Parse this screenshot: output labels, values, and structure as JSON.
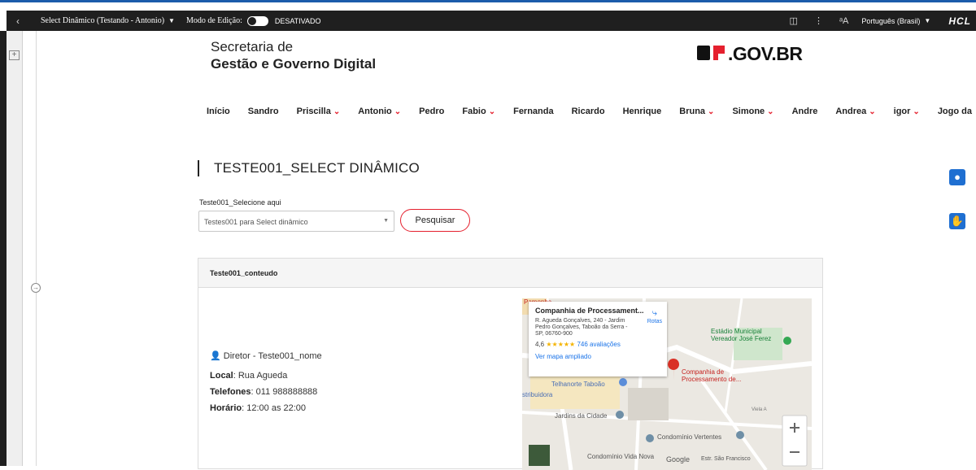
{
  "topbar": {
    "page_select": "Select Dinâmico (Testando - Antonio)",
    "edit_mode_label": "Modo de Edição:",
    "edit_mode_state": "DESATIVADO",
    "language": "Português (Brasil)",
    "brand": "HCL"
  },
  "header": {
    "line1": "Secretaria de",
    "line2": "Gestão e Governo Digital",
    "logo": "SP.GOV.BR"
  },
  "nav": {
    "items": [
      {
        "label": "Início",
        "dropdown": false
      },
      {
        "label": "Sandro",
        "dropdown": false
      },
      {
        "label": "Priscilla",
        "dropdown": true
      },
      {
        "label": "Antonio",
        "dropdown": true
      },
      {
        "label": "Pedro",
        "dropdown": false
      },
      {
        "label": "Fabio",
        "dropdown": true
      },
      {
        "label": "Fernanda",
        "dropdown": false
      },
      {
        "label": "Ricardo",
        "dropdown": false
      },
      {
        "label": "Henrique",
        "dropdown": false
      },
      {
        "label": "Bruna",
        "dropdown": true
      },
      {
        "label": "Simone",
        "dropdown": true
      },
      {
        "label": "Andre",
        "dropdown": false
      },
      {
        "label": "Andrea",
        "dropdown": true
      },
      {
        "label": "igor",
        "dropdown": true
      },
      {
        "label": "Jogo da",
        "dropdown": false
      }
    ]
  },
  "main": {
    "title": "TESTE001_SELECT DINÂMICO",
    "field_label": "Teste001_Selecione aqui",
    "select_value": "Testes001 para Select dinâmico",
    "search_button": "Pesquisar",
    "card_title": "Teste001_conteudo",
    "director": "Diretor - Teste001_nome",
    "local_label": "Local",
    "local_value": ": Rua Agueda",
    "phone_label": "Telefones",
    "phone_value": ": 011 988888888",
    "hours_label": "Horário",
    "hours_value": ": 12:00 as 22:00"
  },
  "map": {
    "place_title": "Companhia de Processament...",
    "address": "R. Agueda Gonçalves, 240 - Jardim Pedro Gonçalves, Taboão da Serra - SP, 06760-900",
    "rating": "4,6",
    "stars": "★★★★★",
    "reviews": "746 avaliações",
    "larger_map": "Ver mapa ampliado",
    "directions": "Rotas",
    "label_stadium": "Estádio Municipal Vereador José Ferez",
    "label_company": "Companhia de Processamento de...",
    "label_telhanorte": "Telhanorte Taboão",
    "label_jardins": "Jardins da Cidade",
    "label_vertentes": "Condomínio Vertentes",
    "label_vida": "Condomínio Vida Nova",
    "label_distribuidora": "stribuidora",
    "label_pamonha": "Pamonha",
    "label_estr": "Estr. São Francisco",
    "label_viela": "Viela A",
    "google": "Google"
  }
}
